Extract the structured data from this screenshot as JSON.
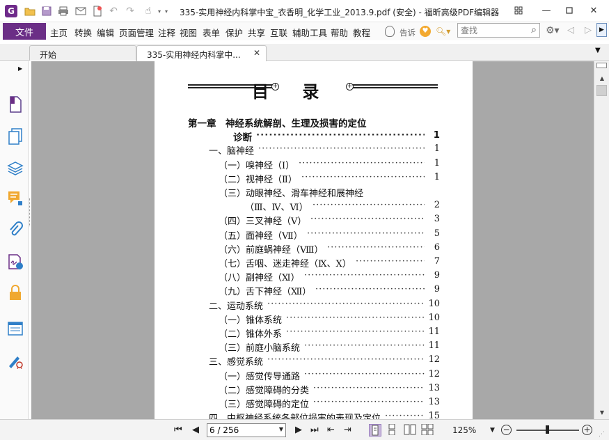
{
  "window": {
    "title": "335-实用神经内科掌中宝_衣香明_化学工业_2013.9.pdf (安全) - 福昕高级PDF编辑器",
    "app_icon": "G"
  },
  "menu": {
    "file": "文件",
    "items": [
      "主页",
      "转换",
      "编辑",
      "页面管理",
      "注释",
      "视图",
      "表单",
      "保护",
      "共享",
      "互联",
      "辅助工具",
      "帮助",
      "教程"
    ],
    "tell_me": "告诉",
    "search_placeholder": "查找"
  },
  "tabs": [
    {
      "label": "开始"
    },
    {
      "label": "335-实用神经内科掌中..."
    }
  ],
  "document": {
    "toc_heading": "目 录",
    "entries": [
      {
        "text": "第一章　神经系统解剖、生理及损害的定位",
        "page": "",
        "level": "chapter"
      },
      {
        "text": "诊断",
        "page": "1",
        "level": "chapter-cont"
      },
      {
        "text": "一、脑神经",
        "page": "1",
        "level": "1"
      },
      {
        "text": "（一）嗅神经（Ⅰ）",
        "page": "1",
        "level": "2"
      },
      {
        "text": "（二）视神经（Ⅱ）",
        "page": "1",
        "level": "2"
      },
      {
        "text": "（三）动眼神经、滑车神经和展神经",
        "page": "",
        "level": "2"
      },
      {
        "text": "（Ⅲ、Ⅳ、Ⅵ）",
        "page": "2",
        "level": "3"
      },
      {
        "text": "（四）三叉神经（Ⅴ）",
        "page": "3",
        "level": "2"
      },
      {
        "text": "（五）面神经（Ⅶ）",
        "page": "5",
        "level": "2"
      },
      {
        "text": "（六）前庭蜗神经（Ⅷ）",
        "page": "6",
        "level": "2"
      },
      {
        "text": "（七）舌咽、迷走神经（Ⅸ、Ⅹ）",
        "page": "7",
        "level": "2"
      },
      {
        "text": "（八）副神经（Ⅺ）",
        "page": "9",
        "level": "2"
      },
      {
        "text": "（九）舌下神经（Ⅻ）",
        "page": "9",
        "level": "2"
      },
      {
        "text": "二、运动系统",
        "page": "10",
        "level": "1"
      },
      {
        "text": "（一）锥体系统",
        "page": "10",
        "level": "2"
      },
      {
        "text": "（二）锥体外系",
        "page": "11",
        "level": "2"
      },
      {
        "text": "（三）前庭小脑系统",
        "page": "11",
        "level": "2"
      },
      {
        "text": "三、感觉系统",
        "page": "12",
        "level": "1"
      },
      {
        "text": "（一）感觉传导通路",
        "page": "12",
        "level": "2"
      },
      {
        "text": "（二）感觉障碍的分类",
        "page": "13",
        "level": "2"
      },
      {
        "text": "（三）感觉障碍的定位",
        "page": "13",
        "level": "2"
      },
      {
        "text": "四、中枢神经系统各部位损害的表现及定位",
        "page": "15",
        "level": "1"
      }
    ]
  },
  "statusbar": {
    "page_field": "6 / 256",
    "zoom": "125%"
  },
  "colors": {
    "accent": "#6b2e86",
    "doc_background": "#a8a8a8"
  }
}
